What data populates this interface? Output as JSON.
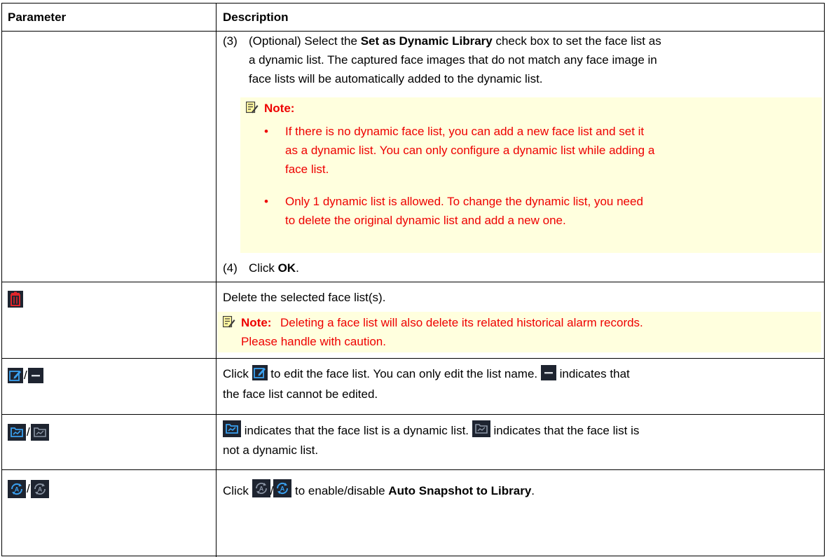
{
  "table": {
    "header": {
      "param": "Parameter",
      "desc": "Description"
    },
    "row_add": {
      "step3_num": "(3)",
      "step3_pre": "(Optional) Select the ",
      "step3_bold": "Set as Dynamic Library",
      "step3_post_l1": " check box to set the face list as",
      "step3_l2": "a dynamic list. The captured face images that do not match any face image in",
      "step3_l3": "face lists will be automatically added to the dynamic list.",
      "note_label": "Note:",
      "bullet1_l1": "If there is no dynamic face list, you can add a new face list and set it",
      "bullet1_l2": "as a dynamic list. You can only configure a dynamic list while adding a",
      "bullet1_l3": "face list.",
      "bullet2_l1": "Only 1 dynamic list is allowed. To change the dynamic list, you need",
      "bullet2_l2": "to delete the original dynamic list and add a new one.",
      "step4_num": "(4)",
      "step4_pre": "Click ",
      "step4_bold": "OK",
      "step4_post": "."
    },
    "row_delete": {
      "desc": "Delete the selected face list(s).",
      "note_label": "Note:",
      "note_l1": "Deleting a face list will also delete its related historical alarm records.",
      "note_l2": "Please handle with caution."
    },
    "row_edit": {
      "slash": "/",
      "pre": "Click ",
      "mid": " to edit the face list. You can only edit the list name. ",
      "post": " indicates that",
      "l2": "the face list cannot be edited."
    },
    "row_dynamic": {
      "slash": "/",
      "a": " indicates that the face list is a dynamic list. ",
      "b": " indicates that the face list is",
      "l2": "not a dynamic list."
    },
    "row_snapshot": {
      "slash": "/",
      "pre": "Click ",
      "slash2": "/",
      "mid": " to enable/disable ",
      "bold": "Auto Snapshot to Library",
      "post": "."
    }
  },
  "colors": {
    "note_red": "#ee0000",
    "note_bg": "#ffffde",
    "icon_dark": "#1e2430",
    "icon_blue": "#2b8fe0",
    "delete_red": "#e0252a"
  },
  "icons": [
    "note-icon",
    "delete-icon",
    "edit-icon",
    "not-editable-icon",
    "dynamic-list-icon",
    "non-dynamic-list-icon",
    "auto-snapshot-on-icon",
    "auto-snapshot-off-icon"
  ]
}
